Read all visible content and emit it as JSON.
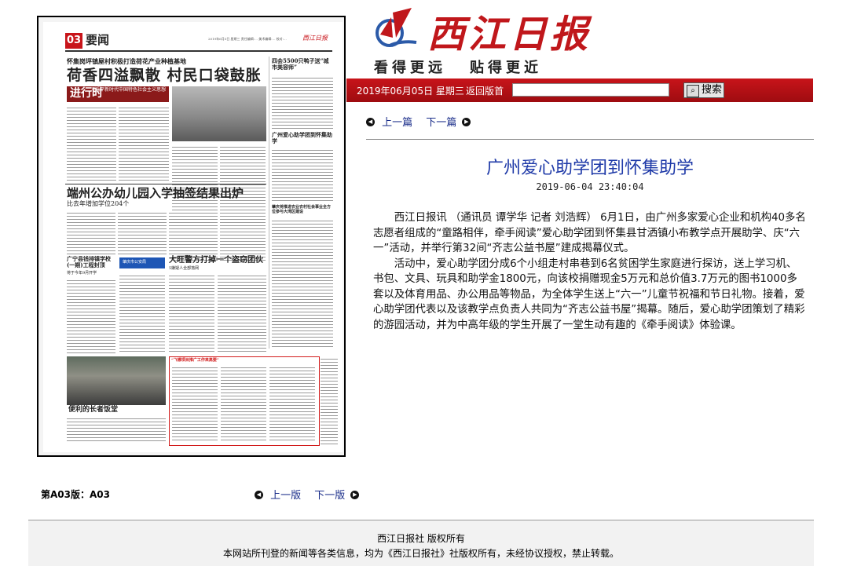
{
  "paper": {
    "page_no": "03",
    "section": "要闻",
    "header_small": "2019年6月5日 星期三  责任编辑:...  美术编辑:...  校对:...",
    "paper_name_small": "西江日报",
    "kicker1": "怀集岗坪镇屋村积极打造荷花产业种植基地",
    "headline1": "荷香四溢飘散 村民口袋鼓胀",
    "side_kicker": "四会5500只鸭子送“城市美容师”",
    "red_box_line1": "习近平新时代中国特色社会主义思想",
    "red_box_line2": "进行时",
    "side_head2": "广州爱心助学团到怀集助学",
    "headline2": "端州公办幼儿园入学抽签结果出炉",
    "subhead2": "比去年增加学位204个",
    "left_box_head": "广宁县钱排镇学校(一期)工程封顶",
    "left_box_sub": "将于今年9月开学",
    "logo_small": "肇庆市公安局",
    "headline3": "大旺警方打掉一个盗窃团伙",
    "subhead3": "5嫌疑人全部落网",
    "side_head3": "肇庆将推进农业农村社会事业全方位参与大湾区建设",
    "photo_caption": "便利的长者饭堂",
    "bottom_box_head": "“飞镖项目推广工作来高要”"
  },
  "brand": {
    "logo_text": "西江日报",
    "slogan_left": "看得更远",
    "slogan_right": "贴得更近"
  },
  "toolbar": {
    "date": "2019年06月05日  星期三",
    "home_link": "返回版首",
    "search_placeholder": "",
    "search_label": "搜索"
  },
  "nav": {
    "prev": "上一篇",
    "next": "下一篇",
    "prev_page": "上一版",
    "next_page": "下一版"
  },
  "article": {
    "title": "广州爱心助学团到怀集助学",
    "time": "2019-06-04 23:40:04",
    "paragraphs": [
      "西江日报讯 （通讯员 谭学华 记者 刘浩辉） 6月1日，由广州多家爱心企业和机构40多名志愿者组成的“童路相伴，牵手阅读”爱心助学团到怀集县甘洒镇小布教学点开展助学、庆“六一”活动，并举行第32间“齐志公益书屋”建成揭幕仪式。",
      "活动中，爱心助学团分成6个小组走村串巷到6名贫困学生家庭进行探访，送上学习机、书包、文具、玩具和助学金1800元，向该校捐赠现金5万元和总价值3.7万元的图书1000多套以及体育用品、办公用品等物品，为全体学生送上“六一”儿童节祝福和节日礼物。接着，爱心助学团代表以及该教学点负责人共同为“齐志公益书屋”揭幕。随后，爱心助学团策划了精彩的游园活动，并为中高年级的学生开展了一堂生动有趣的《牵手阅读》体验课。"
    ]
  },
  "page": {
    "label": "第A03版：A03"
  },
  "footer": {
    "line1": "西江日报社 版权所有",
    "line2": "本网站所刊登的新闻等各类信息，均为《西江日报社》社版权所有，未经协议授权，禁止转载。"
  },
  "colors": {
    "brand_red": "#c0171b",
    "link_blue": "#1a2d8a",
    "title_blue": "#1f3aa8"
  }
}
